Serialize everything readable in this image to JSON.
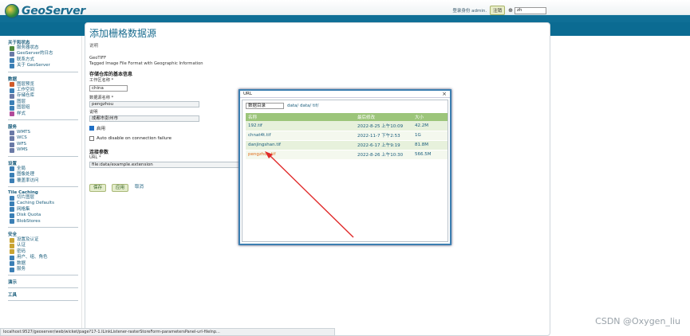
{
  "header": {
    "app_name": "GeoServer",
    "login_text": "登录身份 admin.",
    "logout_label": "注销",
    "lang_value": "zh"
  },
  "sidebar": {
    "sections": [
      {
        "title": "关于和状态",
        "items": [
          {
            "label": "服务器状态",
            "icon": "server-icon",
            "color": "#4e8a3a"
          },
          {
            "label": "GeoServer的日志",
            "icon": "log-icon",
            "color": "#6a7aa6"
          },
          {
            "label": "联系方式",
            "icon": "contact-icon",
            "color": "#3b7fb5"
          },
          {
            "label": "关于 GeoServer",
            "icon": "info-icon",
            "color": "#3b7fb5"
          }
        ]
      },
      {
        "title": "数据",
        "items": [
          {
            "label": "图层预览",
            "icon": "preview-icon",
            "color": "#d05a2a"
          },
          {
            "label": "工作空间",
            "icon": "workspace-icon",
            "color": "#3b7fb5"
          },
          {
            "label": "存储仓库",
            "icon": "store-icon",
            "color": "#6a7aa6"
          },
          {
            "label": "图层",
            "icon": "layer-icon",
            "color": "#3b7fb5"
          },
          {
            "label": "图层组",
            "icon": "layergroup-icon",
            "color": "#3b7fb5"
          },
          {
            "label": "样式",
            "icon": "style-icon",
            "color": "#b24a9a"
          }
        ]
      },
      {
        "title": "服务",
        "items": [
          {
            "label": "WMTS",
            "icon": "wmts-icon",
            "color": "#6a7aa6"
          },
          {
            "label": "WCS",
            "icon": "wcs-icon",
            "color": "#6a7aa6"
          },
          {
            "label": "WFS",
            "icon": "wfs-icon",
            "color": "#6a7aa6"
          },
          {
            "label": "WMS",
            "icon": "wms-icon",
            "color": "#6a7aa6"
          }
        ]
      },
      {
        "title": "设置",
        "items": [
          {
            "label": "全局",
            "icon": "global-icon",
            "color": "#3b7fb5"
          },
          {
            "label": "图像处理",
            "icon": "image-icon",
            "color": "#3b7fb5"
          },
          {
            "label": "覆盖率访问",
            "icon": "coverage-icon",
            "color": "#3b7fb5"
          }
        ]
      },
      {
        "title": "Tile Caching",
        "items": [
          {
            "label": "切片图层",
            "icon": "tile-layer-icon",
            "color": "#3b7fb5"
          },
          {
            "label": "Caching Defaults",
            "icon": "caching-icon",
            "color": "#3b7fb5"
          },
          {
            "label": "网格集",
            "icon": "gridset-icon",
            "color": "#3b7fb5"
          },
          {
            "label": "Disk Quota",
            "icon": "disk-icon",
            "color": "#3b7fb5"
          },
          {
            "label": "BlobStores",
            "icon": "blobstore-icon",
            "color": "#3b7fb5"
          }
        ]
      },
      {
        "title": "安全",
        "items": [
          {
            "label": "设置及认证",
            "icon": "security-settings-icon",
            "color": "#c9a434"
          },
          {
            "label": "认证",
            "icon": "auth-icon",
            "color": "#c9a434"
          },
          {
            "label": "密码",
            "icon": "password-icon",
            "color": "#c9a434"
          },
          {
            "label": "用户、组、角色",
            "icon": "users-icon",
            "color": "#3b7fb5"
          },
          {
            "label": "数据",
            "icon": "data-security-icon",
            "color": "#3b7fb5"
          },
          {
            "label": "服务",
            "icon": "service-security-icon",
            "color": "#3b7fb5"
          }
        ]
      },
      {
        "title": "演示",
        "items": []
      },
      {
        "title": "工具",
        "items": []
      }
    ]
  },
  "main": {
    "title": "添加栅格数据源",
    "desc": "说明",
    "format_name": "GeoTIFF",
    "format_desc": "Tagged Image File Format with Geographic Information",
    "basic_info": "存储仓库的基本信息",
    "workspace_label": "工作区名称 *",
    "workspace_value": "china",
    "ds_name_label": "数据源名称 *",
    "ds_name_value": "pengzhou",
    "desc_label": "说明",
    "desc_value": "成都市彭州市",
    "enabled_label": "启用",
    "auto_disable_label": "Auto disable on connection failure",
    "conn_params": "连接参数",
    "url_label": "URL *",
    "url_value": "file:data/example.extension",
    "save_label": "保存",
    "apply_label": "应用",
    "cancel_label": "取消"
  },
  "modal": {
    "title": "URL",
    "close": "×",
    "dir_select": "数据目录",
    "path": "data/ data/ tif/",
    "columns": [
      "名称",
      "最后修改",
      "大小"
    ],
    "files": [
      {
        "name": "192.tif",
        "modified": "2022-8-25 上午10:09",
        "size": "42.2M"
      },
      {
        "name": "chnat4t.tif",
        "modified": "2022-11-7 下午2:53",
        "size": "1G"
      },
      {
        "name": "danjingshan.tif",
        "modified": "2022-6-17 上午9:19",
        "size": "81.8M"
      },
      {
        "name": "pengzhou.tif",
        "modified": "2022-8-26 上午10:30",
        "size": "566.5M"
      }
    ]
  },
  "statusbar": "localhost:9527/geoserver/web/wicket/page?17-1.ILinkListener-rasterStoreForm-parametersPanel-url-fileInp...",
  "watermark": "CSDN @Oxygen_liu"
}
